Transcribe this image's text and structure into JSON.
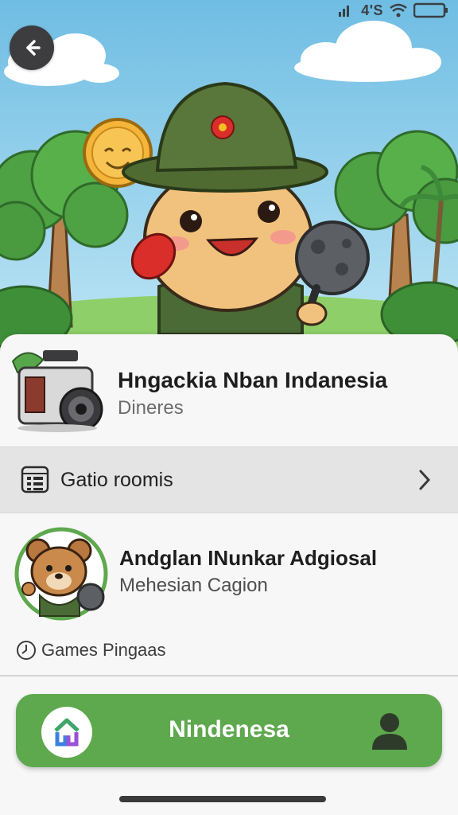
{
  "status_bar": {
    "network": "4'S"
  },
  "header": {
    "title": "Hngackia Nban Indanesia",
    "subtitle": "Dineres"
  },
  "rooms": {
    "label": "Gatio roomis"
  },
  "player": {
    "name": "Andglan INunkar Adgiosal",
    "subtitle": "Mehesian Cagion",
    "games_label": "Games Pingaas"
  },
  "cta": {
    "label": "Nindenesa"
  },
  "colors": {
    "sky": "#79c3e5",
    "grass": "#8fcf6a",
    "accent_green": "#5ea84e",
    "sheet_bg": "#f7f7f7",
    "row_bg": "#e4e4e4"
  },
  "icons": [
    "back-arrow-icon",
    "signal-icon",
    "wifi-icon",
    "battery-icon",
    "camera-icon",
    "calendar-icon",
    "chevron-right-icon",
    "clock-icon",
    "home-logo-icon",
    "profile-icon"
  ]
}
